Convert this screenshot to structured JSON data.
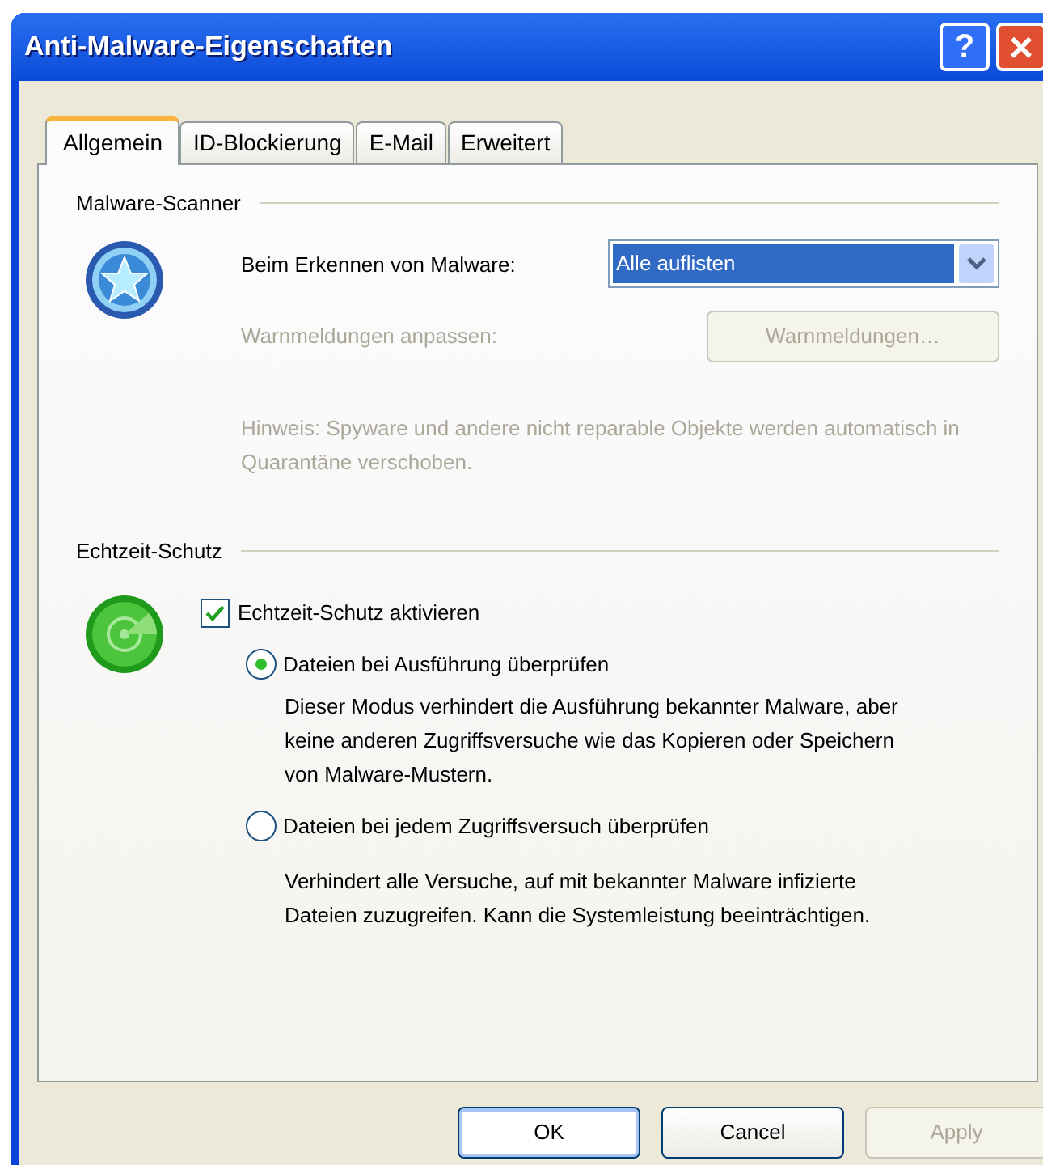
{
  "window": {
    "title": "Anti-Malware-Eigenschaften"
  },
  "title_buttons": [
    "?",
    "×"
  ],
  "tabs": [
    {
      "label": "Allgemein",
      "selected": true
    },
    {
      "label": "ID-Blockierung",
      "selected": false
    },
    {
      "label": "E-Mail",
      "selected": false
    },
    {
      "label": "Erweitert",
      "selected": false
    }
  ],
  "scanner": {
    "heading": "Malware-Scanner",
    "detect_label": "Beim Erkennen von Malware:",
    "detect_value": "Alle auflisten",
    "alerts_label": "Warnmeldungen anpassen:",
    "alerts_button": "Warnmeldungen…",
    "alerts_disabled": true,
    "note": "Hinweis: Spyware und andere nicht reparable Objekte werden automatisch in Quarantäne verschoben."
  },
  "realtime": {
    "heading": "Echtzeit-Schutz",
    "enable_label": "Echtzeit-Schutz aktivieren",
    "checked": true,
    "options": [
      {
        "label": "Dateien bei Ausführung überprüfen",
        "selected": true,
        "description": "Dieser Modus verhindert die Ausführung bekannter Malware, aber keine anderen Zugriffsversuche wie das Kopieren oder Speichern von Malware-Mustern."
      },
      {
        "label": "Dateien bei jedem Zugriffsversuch überprüfen",
        "selected": false,
        "description": "Verhindert alle Versuche, auf mit bekannter Malware infizierte Dateien zuzugreifen. Kann die Systemleistung beeinträchtigen."
      }
    ]
  },
  "buttons": [
    {
      "label": "OK",
      "kind": "default",
      "disabled": false
    },
    {
      "label": "Cancel",
      "kind": "normal",
      "disabled": false
    },
    {
      "label": "Apply",
      "kind": "normal",
      "disabled": true
    }
  ]
}
